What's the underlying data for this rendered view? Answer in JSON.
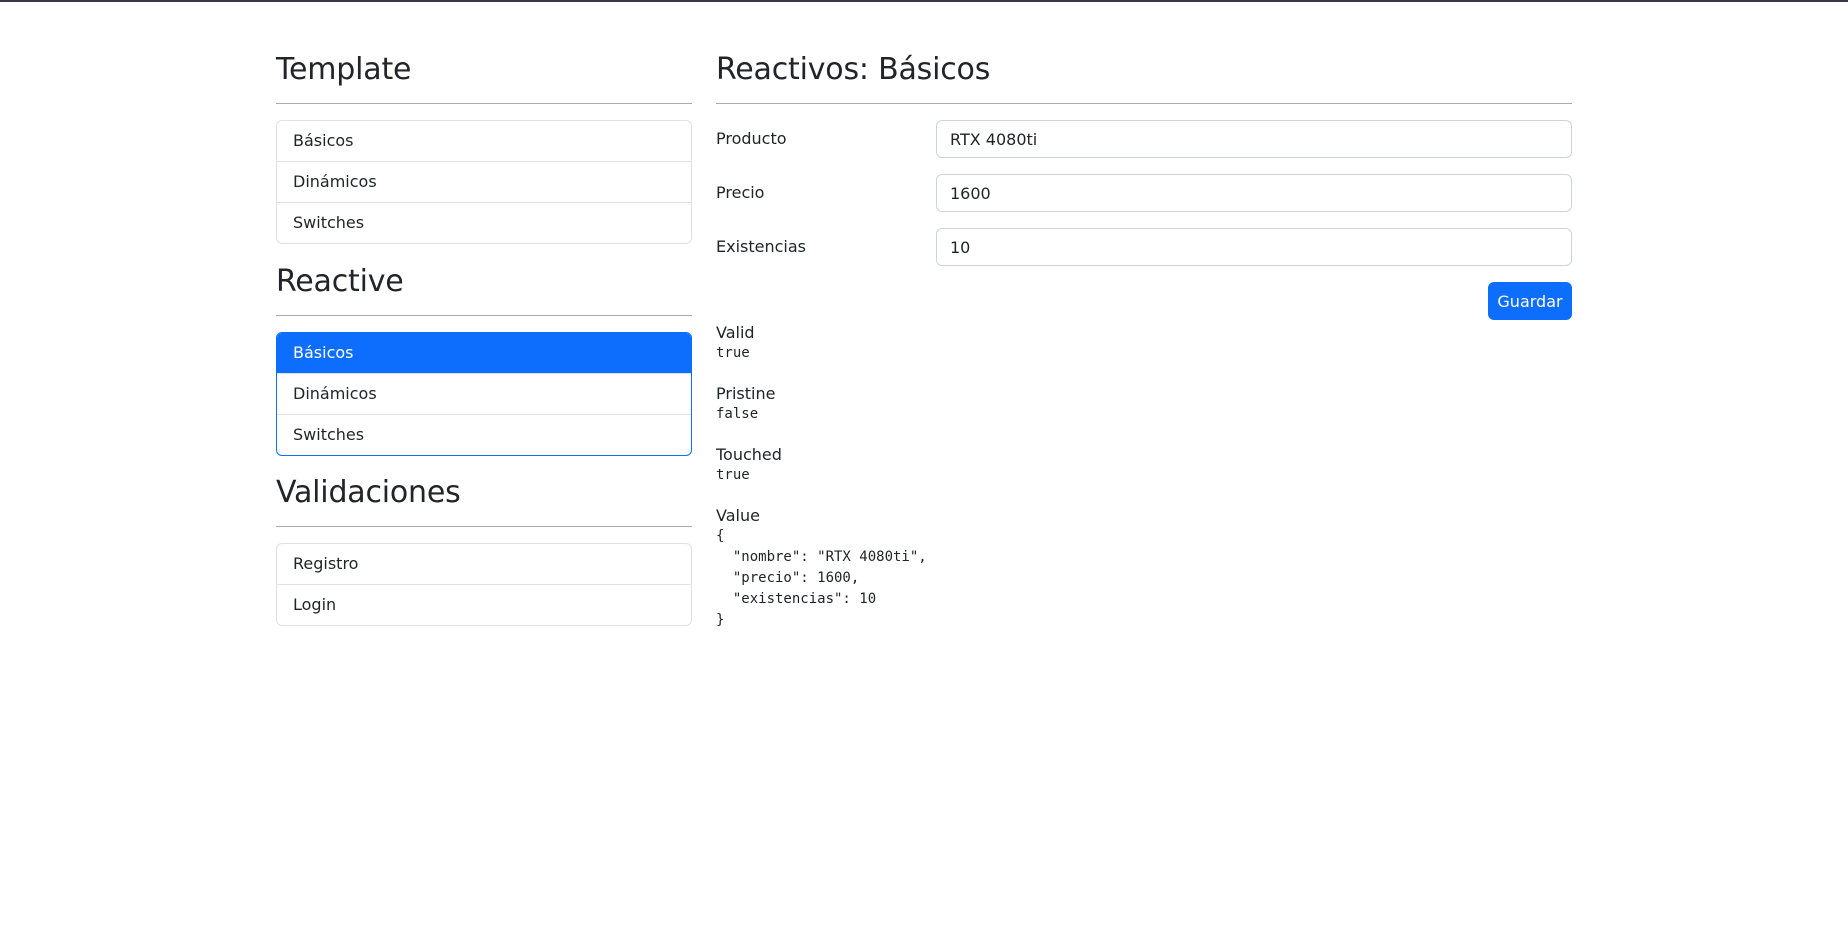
{
  "sidebar": {
    "sections": [
      {
        "title": "Template",
        "items": [
          "Básicos",
          "Dinámicos",
          "Switches"
        ]
      },
      {
        "title": "Reactive",
        "items": [
          "Básicos",
          "Dinámicos",
          "Switches"
        ],
        "active_item": "Básicos"
      },
      {
        "title": "Validaciones",
        "items": [
          "Registro",
          "Login"
        ]
      }
    ]
  },
  "main": {
    "title": "Reactivos: Básicos",
    "form": {
      "fields": [
        {
          "label": "Producto",
          "value": "RTX 4080ti"
        },
        {
          "label": "Precio",
          "value": "1600"
        },
        {
          "label": "Existencias",
          "value": "10"
        }
      ],
      "submit_label": "Guardar"
    },
    "status": [
      {
        "label": "Valid",
        "value": "true"
      },
      {
        "label": "Pristine",
        "value": "false"
      },
      {
        "label": "Touched",
        "value": "true"
      },
      {
        "label": "Value",
        "value": "{\n  \"nombre\": \"RTX 4080ti\",\n  \"precio\": 1600,\n  \"existencias\": 10\n}"
      }
    ]
  },
  "colors": {
    "primary": "#0d6efd",
    "text": "#212529",
    "border": "#dee2e6",
    "top_border": "#343a40"
  }
}
